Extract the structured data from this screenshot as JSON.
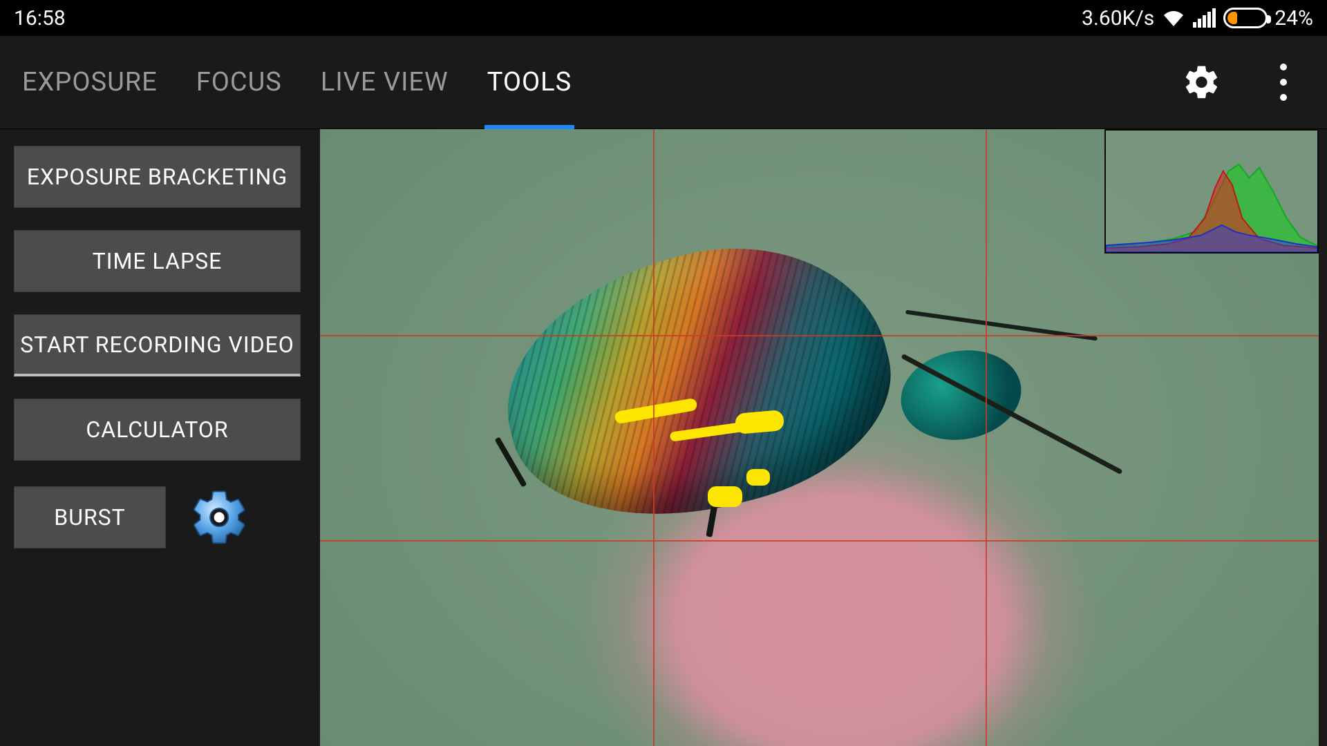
{
  "statusbar": {
    "time": "16:58",
    "network_speed": "3.60K/s",
    "battery_percent": "24%",
    "battery_level": 24
  },
  "tabs": {
    "items": [
      {
        "label": "EXPOSURE",
        "active": false
      },
      {
        "label": "FOCUS",
        "active": false
      },
      {
        "label": "LIVE VIEW",
        "active": false
      },
      {
        "label": "TOOLS",
        "active": true
      }
    ]
  },
  "tools": {
    "exposure_bracketing": "EXPOSURE BRACKETING",
    "time_lapse": "TIME LAPSE",
    "start_recording": "START RECORDING VIDEO",
    "calculator": "CALCULATOR",
    "burst": "BURST"
  },
  "icons": {
    "settings": "gear-icon",
    "overflow": "kebab-icon",
    "burst_settings": "gear-icon",
    "wifi": "wifi-icon",
    "signal": "cellular-signal-icon",
    "battery": "battery-icon"
  },
  "liveview": {
    "subject": "iridescent beetle on pink flower bud (macro)",
    "overlay": "rule-of-thirds grid with focus-peaking highlights",
    "histogram_position": "top-right"
  }
}
